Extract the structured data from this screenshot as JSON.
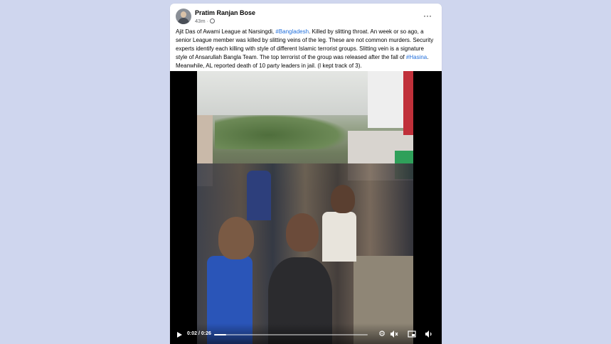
{
  "post": {
    "author": "Pratim Ranjan Bose",
    "time": "43m",
    "text_segments": [
      {
        "text": "Ajit Das of Awami League at Narsingdi, ",
        "type": "text"
      },
      {
        "text": "#Bangladesh",
        "type": "hashtag"
      },
      {
        "text": ". Killed by slitting throat. An week or so ago, a senior League member was killed by slitting veins of the leg. These are not common murders. Security experts identify each killing with style of different Islamic terrorist groups. Slitting vein is a signature style of Ansarullah Bangla Team. The top terrorist of the group was released after the fall of ",
        "type": "text"
      },
      {
        "text": "#Hasina",
        "type": "hashtag"
      },
      {
        "text": ". Meanwhile, AL reported death of 10 party leaders in jail. (I kept track of 3).",
        "type": "text"
      }
    ]
  },
  "video": {
    "current_time": "0:02",
    "duration": "0:26",
    "progress": 0.08,
    "time_separator": " / "
  },
  "icons": {
    "more": "more-horizontal-icon",
    "privacy": "globe-icon",
    "play": "play-icon",
    "settings": "gear-icon",
    "mute": "mute-icon",
    "pip": "picture-in-picture-icon",
    "volume": "volume-icon"
  },
  "colors": {
    "background": "#cfd6ee",
    "hashtag": "#216fdb",
    "text": "#050505",
    "meta": "#65676b"
  }
}
